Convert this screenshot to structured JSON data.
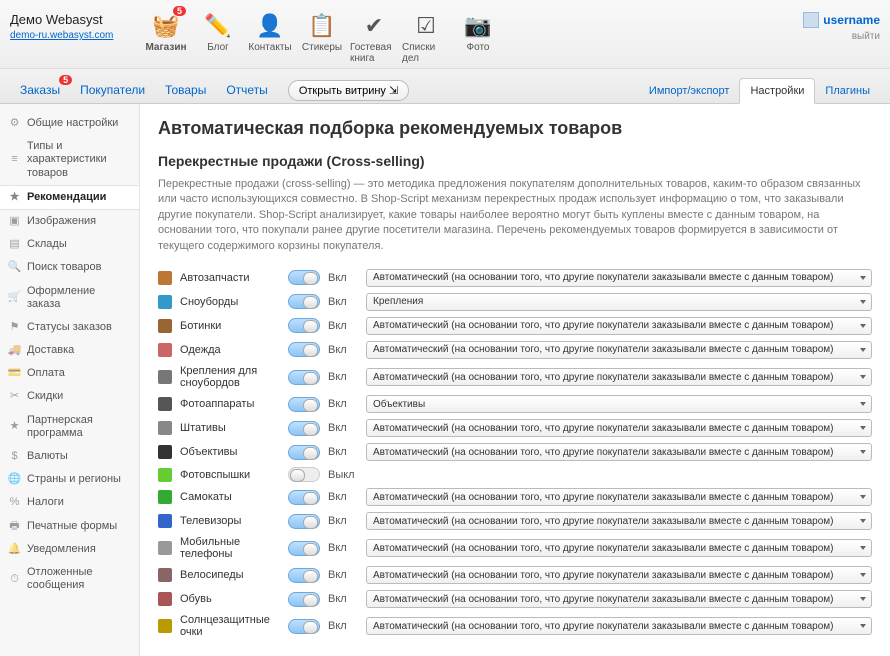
{
  "brand": {
    "title": "Демо Webasyst",
    "link": "demo-ru.webasyst.com"
  },
  "user": {
    "name": "username",
    "logout": "выйти"
  },
  "apps": [
    {
      "label": "Магазин",
      "badge": "5",
      "icon": "🧺",
      "color": "#6b3"
    },
    {
      "label": "Блог",
      "icon": "✏️"
    },
    {
      "label": "Контакты",
      "icon": "👤"
    },
    {
      "label": "Стикеры",
      "icon": "📋"
    },
    {
      "label": "Гостевая книга",
      "icon": "✔"
    },
    {
      "label": "Списки дел",
      "icon": "☑"
    },
    {
      "label": "Фото",
      "icon": "📷"
    }
  ],
  "tabs": [
    {
      "label": "Заказы",
      "badge": "5"
    },
    {
      "label": "Покупатели"
    },
    {
      "label": "Товары"
    },
    {
      "label": "Отчеты"
    }
  ],
  "open_btn": "Открыть витрину",
  "rtabs": [
    {
      "label": "Импорт/экспорт"
    },
    {
      "label": "Настройки",
      "active": true
    },
    {
      "label": "Плагины"
    }
  ],
  "sidebar": [
    {
      "label": "Общие настройки",
      "ic": "⚙"
    },
    {
      "label": "Типы и характеристики товаров",
      "ic": "≡"
    },
    {
      "label": "Рекомендации",
      "ic": "★",
      "active": true
    },
    {
      "label": "Изображения",
      "ic": "▣"
    },
    {
      "label": "Склады",
      "ic": "▤"
    },
    {
      "label": "Поиск товаров",
      "ic": "🔍"
    },
    {
      "label": "Оформление заказа",
      "ic": "🛒"
    },
    {
      "label": "Статусы заказов",
      "ic": "⚑"
    },
    {
      "label": "Доставка",
      "ic": "🚚"
    },
    {
      "label": "Оплата",
      "ic": "💳"
    },
    {
      "label": "Скидки",
      "ic": "✂"
    },
    {
      "label": "Партнерская программа",
      "ic": "★"
    },
    {
      "label": "Валюты",
      "ic": "$"
    },
    {
      "label": "Страны и регионы",
      "ic": "🌐"
    },
    {
      "label": "Налоги",
      "ic": "%"
    },
    {
      "label": "Печатные формы",
      "ic": "🖶"
    },
    {
      "label": "Уведомления",
      "ic": "🔔"
    },
    {
      "label": "Отложенные сообщения",
      "ic": "⏱"
    }
  ],
  "page": {
    "title": "Автоматическая подборка рекомендуемых товаров",
    "subtitle": "Перекрестные продажи (Cross-selling)",
    "desc": "Перекрестные продажи (cross-selling) — это методика предложения покупателям дополнительных товаров, каким-то образом связанных или часто использующихся совместно. В Shop-Script механизм перекрестных продаж использует информацию о том, что заказывали другие покупатели. Shop-Script анализирует, какие товары наиболее вероятно могут быть куплены вместе с данным товаром, на основании того, что покупали ранее другие посетители магазина. Перечень рекомендуемых товаров формируется в зависимости от текущего содержимого корзины покупателя."
  },
  "state": {
    "on": "Вкл",
    "off": "Выкл"
  },
  "sel_auto": "Автоматический (на основании того, что другие покупатели заказывали вместе с данным товаром)",
  "categories": [
    {
      "name": "Автозапчасти",
      "c": "#b73",
      "on": true,
      "sel": "auto"
    },
    {
      "name": "Сноуборды",
      "c": "#39c",
      "on": true,
      "sel": "Крепления"
    },
    {
      "name": "Ботинки",
      "c": "#963",
      "on": true,
      "sel": "auto"
    },
    {
      "name": "Одежда",
      "c": "#c66",
      "on": true,
      "sel": "auto"
    },
    {
      "name": "Крепления для сноубордов",
      "c": "#777",
      "on": true,
      "sel": "auto"
    },
    {
      "name": "Фотоаппараты",
      "c": "#555",
      "on": true,
      "sel": "Объективы"
    },
    {
      "name": "Штативы",
      "c": "#888",
      "on": true,
      "sel": "auto"
    },
    {
      "name": "Объективы",
      "c": "#333",
      "on": true,
      "sel": "auto"
    },
    {
      "name": "Фотовспышки",
      "c": "#6c3",
      "on": false
    },
    {
      "name": "Самокаты",
      "c": "#3a3",
      "on": true,
      "sel": "auto"
    },
    {
      "name": "Телевизоры",
      "c": "#36c",
      "on": true,
      "sel": "auto"
    },
    {
      "name": "Мобильные телефоны",
      "c": "#999",
      "on": true,
      "sel": "auto"
    },
    {
      "name": "Велосипеды",
      "c": "#866",
      "on": true,
      "sel": "auto"
    },
    {
      "name": "Обувь",
      "c": "#a55",
      "on": true,
      "sel": "auto"
    },
    {
      "name": "Солнцезащитные очки",
      "c": "#b90",
      "on": true,
      "sel": "auto"
    }
  ]
}
